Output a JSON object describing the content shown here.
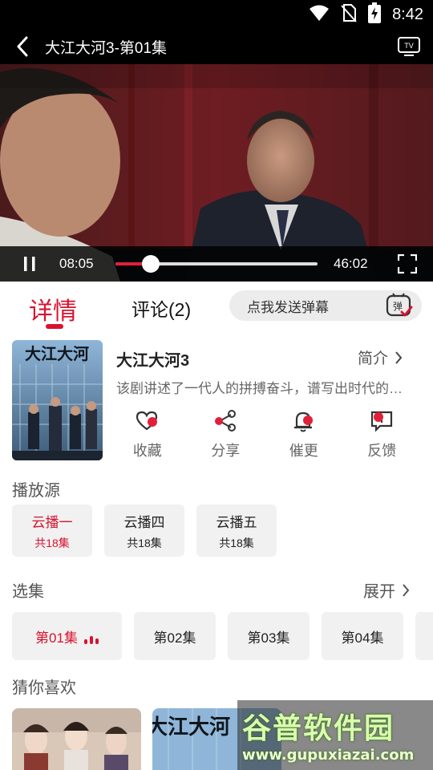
{
  "status_bar": {
    "time": "8:42"
  },
  "player": {
    "title": "大江大河3-第01集",
    "current_time": "08:05",
    "total_time": "46:02",
    "progress": 0.175
  },
  "tabs": {
    "detail": "详情",
    "comment": "评论(2)",
    "danmu_placeholder": "点我发送弹幕",
    "danmu_icon_char": "弹"
  },
  "show": {
    "title": "大江大河3",
    "intro_label": "简介",
    "description": "该剧讲述了一代人的拼搏奋斗，谱写出时代的…"
  },
  "poster_text": "大江大河",
  "actions": [
    {
      "label": "收藏",
      "icon": "favorite-heart-icon"
    },
    {
      "label": "分享",
      "icon": "share-icon"
    },
    {
      "label": "催更",
      "icon": "urge-update-bell-icon"
    },
    {
      "label": "反馈",
      "icon": "feedback-icon"
    }
  ],
  "sources_section": {
    "title": "播放源",
    "items": [
      {
        "name": "云播一",
        "count": "共18集",
        "active": true
      },
      {
        "name": "云播四",
        "count": "共18集",
        "active": false
      },
      {
        "name": "云播五",
        "count": "共18集",
        "active": false
      }
    ]
  },
  "episodes_section": {
    "title": "选集",
    "expand_label": "展开",
    "items": [
      "第01集",
      "第02集",
      "第03集",
      "第04集"
    ]
  },
  "recommend_section": {
    "title": "猜你喜欢"
  },
  "watermark": {
    "main": "谷普软件园",
    "url": "www.gupuxiazai.com"
  },
  "colors": {
    "accent": "#d8132f",
    "chip_bg": "#f1f1f1"
  }
}
